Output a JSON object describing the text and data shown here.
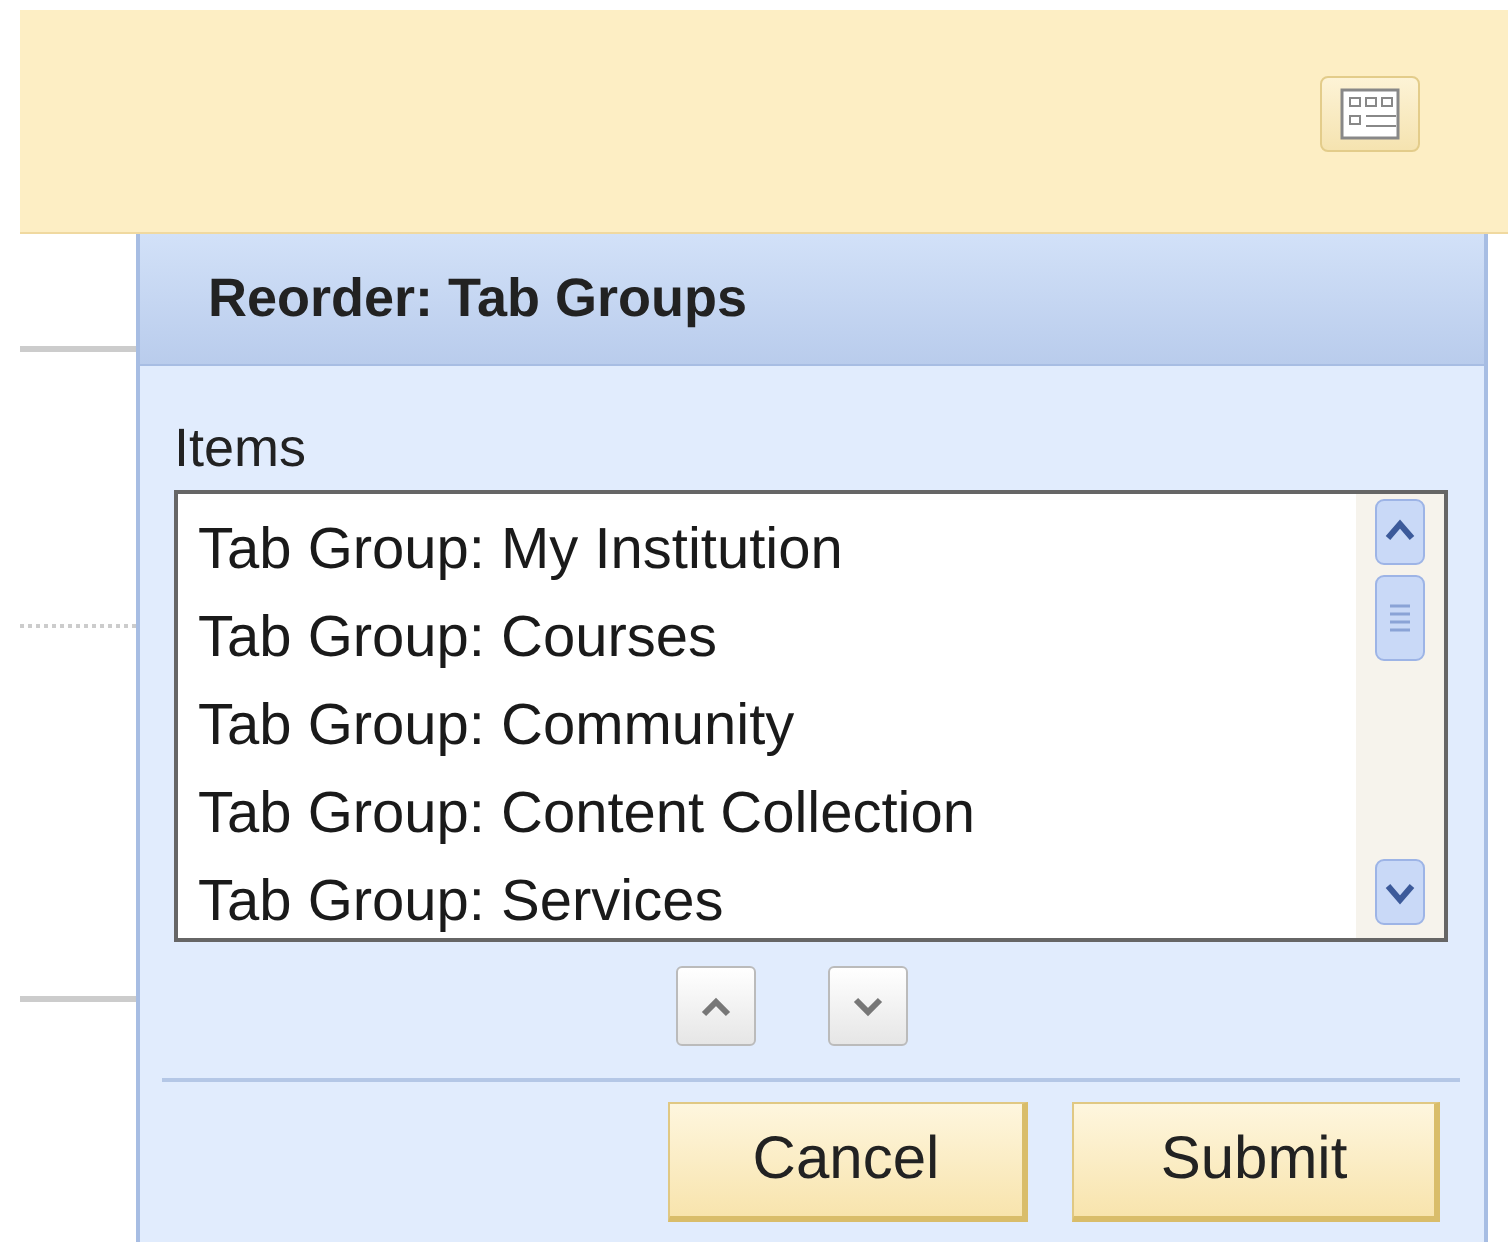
{
  "dialog": {
    "title": "Reorder: Tab Groups",
    "list_label": "Items",
    "items": [
      "Tab Group: My Institution",
      "Tab Group: Courses",
      "Tab Group: Community",
      "Tab Group: Content Collection",
      "Tab Group: Services"
    ],
    "buttons": [
      "Cancel",
      "Submit"
    ]
  }
}
